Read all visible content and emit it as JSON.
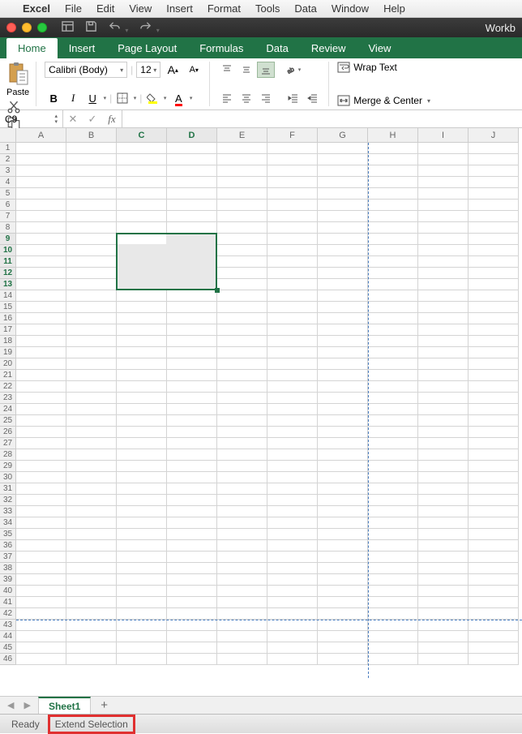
{
  "mac_menu": {
    "app": "Excel",
    "items": [
      "File",
      "Edit",
      "View",
      "Insert",
      "Format",
      "Tools",
      "Data",
      "Window",
      "Help"
    ]
  },
  "window": {
    "title": "Workb"
  },
  "ribbon_tabs": [
    "Home",
    "Insert",
    "Page Layout",
    "Formulas",
    "Data",
    "Review",
    "View"
  ],
  "active_tab": "Home",
  "clipboard": {
    "paste": "Paste"
  },
  "font": {
    "name": "Calibri (Body)",
    "size": "12",
    "grow": "A",
    "shrink": "A",
    "bold": "B",
    "italic": "I",
    "underline": "U",
    "font_color": "A"
  },
  "wrap_merge": {
    "wrap": "Wrap Text",
    "merge": "Merge & Center"
  },
  "name_box": "C9",
  "fx_label": "fx",
  "columns": [
    "A",
    "B",
    "C",
    "D",
    "E",
    "F",
    "G",
    "H",
    "I",
    "J"
  ],
  "selected_cols": [
    "C",
    "D"
  ],
  "row_count": 46,
  "selected_rows": [
    9,
    10,
    11,
    12,
    13
  ],
  "selection": {
    "c1": 2,
    "r1": 8,
    "c2": 3,
    "r2": 12
  },
  "sheet": {
    "name": "Sheet1"
  },
  "status": {
    "ready": "Ready",
    "extend": "Extend Selection"
  },
  "page_break": {
    "col_after": "G",
    "row_after": 42
  }
}
